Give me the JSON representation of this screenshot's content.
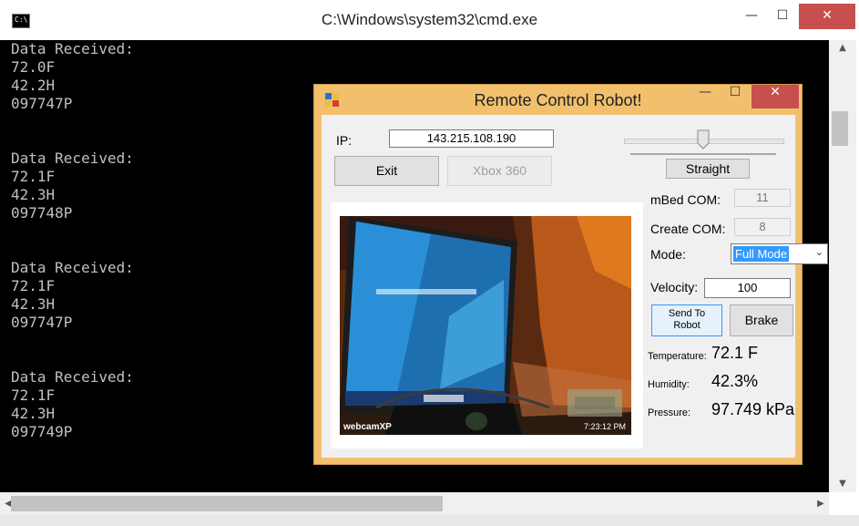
{
  "cmd": {
    "title": "C:\\Windows\\system32\\cmd.exe",
    "icon_text": "C:\\",
    "lines": [
      "Data Received:",
      "72.0F",
      "42.2H",
      "097747P",
      "",
      "",
      "Data Received:",
      "72.1F",
      "42.3H",
      "097748P",
      "",
      "",
      "Data Received:",
      "72.1F",
      "42.3H",
      "097747P",
      "",
      "",
      "Data Received:",
      "72.1F",
      "42.3H",
      "097749P"
    ],
    "controls": {
      "minimize": "—",
      "maximize": "☐",
      "close": "✕"
    }
  },
  "robot": {
    "title": "Remote Control Robot!",
    "controls": {
      "minimize": "—",
      "maximize": "☐",
      "close": "✕"
    },
    "ip_label": "IP:",
    "ip_value": "143.215.108.190",
    "exit_label": "Exit",
    "xbox_label": "Xbox 360",
    "straight_label": "Straight",
    "mbed_label": "mBed COM:",
    "mbed_value": "11",
    "create_label": "Create COM:",
    "create_value": "8",
    "mode_label": "Mode:",
    "mode_value": "Full Mode",
    "velocity_label": "Velocity:",
    "velocity_value": "100",
    "send_label_1": "Send To",
    "send_label_2": "Robot",
    "brake_label": "Brake",
    "temperature_label": "Temperature:",
    "temperature_value": "72.1 F",
    "humidity_label": "Humidity:",
    "humidity_value": "42.3%",
    "pressure_label": "Pressure:",
    "pressure_value": "97.749 kPa",
    "webcam_watermark": "webcamXP",
    "webcam_timestamp": "7:23:12 PM"
  },
  "colors": {
    "window_frame": "#f2c06d",
    "console_bg": "#000000",
    "console_text": "#c0c0c0",
    "close_button": "#c7504f",
    "selection": "#3399ff"
  }
}
